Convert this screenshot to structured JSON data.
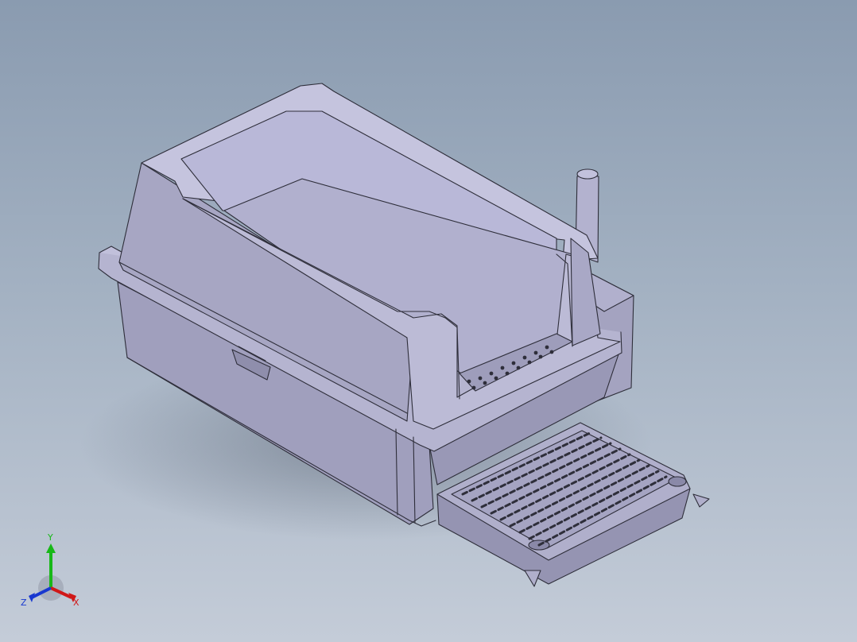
{
  "viewport": {
    "background_top": "#8a9bb0",
    "background_bottom": "#c4ccd8"
  },
  "model": {
    "body_color": "#a9a8c4",
    "body_shade": "#9d9cb8",
    "inner_color": "#b7b6d6",
    "edge_color": "#2e2e3a",
    "mat_color": "#a6a6c0"
  },
  "triad": {
    "x_label": "X",
    "y_label": "Y",
    "z_label": "Z",
    "x_color": "#d01818",
    "y_color": "#18b818",
    "z_color": "#1838d0"
  }
}
